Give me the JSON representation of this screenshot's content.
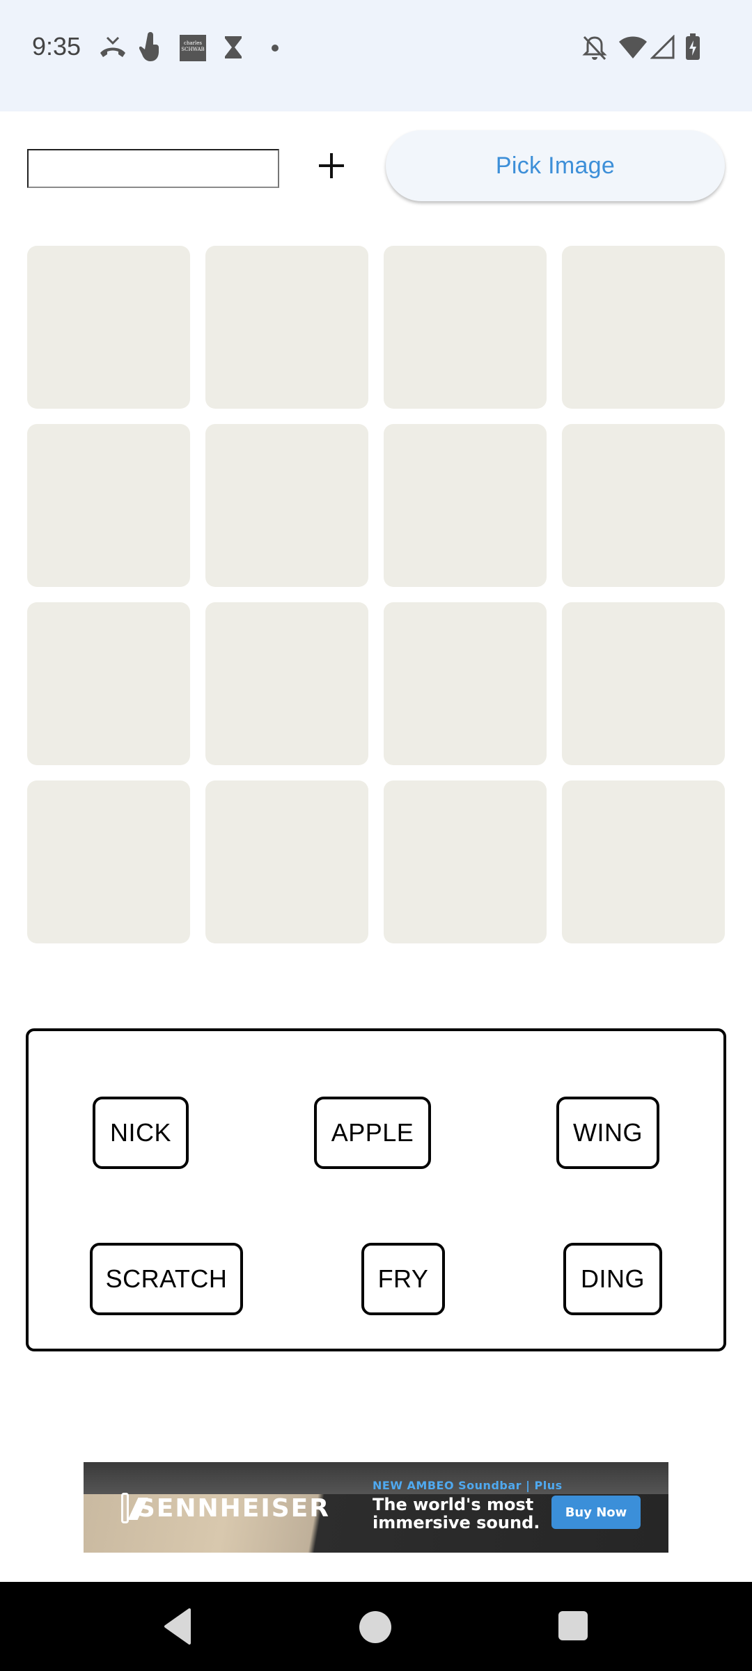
{
  "status_bar": {
    "time": "9:35",
    "left_icons": [
      "missed-call-icon",
      "touch-icon",
      "charles-schwab-icon",
      "hourglass-icon",
      "dot-icon"
    ],
    "right_icons": [
      "bell-off-icon",
      "wifi-icon",
      "signal-icon",
      "battery-icon"
    ],
    "schwab_text": "charles SCHWAB"
  },
  "top_row": {
    "text_field_value": "",
    "plus_icon": "plus-icon",
    "pick_image_label": "Pick Image"
  },
  "grid": {
    "rows": 4,
    "columns": 4
  },
  "words": {
    "row1": [
      "NICK",
      "APPLE",
      "WING"
    ],
    "row2": [
      "SCRATCH",
      "FRY",
      "DING"
    ]
  },
  "ad": {
    "brand": "SENNHEISER",
    "tag": "NEW AMBEO Soundbar | Plus",
    "headline": "The world's most immersive sound.",
    "cta": "Buy Now"
  },
  "nav_bar": {
    "icons": [
      "back-icon",
      "home-icon",
      "recents-icon"
    ]
  },
  "colors": {
    "status_bg": "#eef3fb",
    "accent": "#3d8fd8",
    "cell": "#eeede6"
  }
}
